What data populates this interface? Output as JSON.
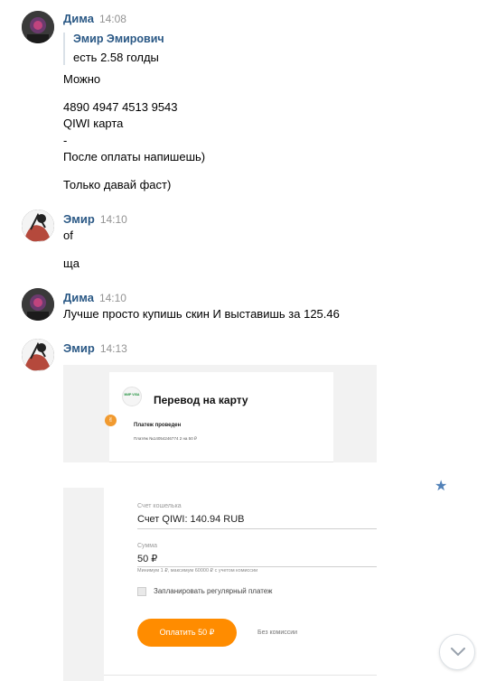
{
  "messages": [
    {
      "author": "Дима",
      "time": "14:08",
      "forward": {
        "name": "Эмир Эмирович",
        "text": "есть 2.58 голды"
      },
      "lines": [
        "Можно",
        "4890 4947 4513 9543",
        "QIWI карта",
        "-",
        "После оплаты напишешь)",
        "Только давай фаст)"
      ]
    },
    {
      "author": "Эмир",
      "time": "14:10",
      "lines": [
        "of",
        "ща"
      ]
    },
    {
      "author": "Дима",
      "time": "14:10",
      "lines": [
        "Лучше просто купишь скин И выставишь за 125.46"
      ]
    },
    {
      "author": "Эмир",
      "time": "14:13",
      "lines": []
    }
  ],
  "screenshot1": {
    "badge": "МИР VISA",
    "title": "Перевод на карту",
    "status": "Платеж проведен",
    "detail": "Платёж №14054246774 2 на 50 ₽"
  },
  "screenshot2": {
    "wallet_label": "Счет кошелька",
    "wallet_value": "Счет QIWI: 140.94 RUB",
    "amount_label": "Сумма",
    "amount_value": "50 ₽",
    "amount_hint": "Минимум 1 ₽, максимум 60000 ₽ с учетом комиссии",
    "schedule_label": "Запланировать регулярный платеж",
    "pay_button": "Оплатить 50 ₽",
    "no_fee": "Без комиссии"
  },
  "icons": {
    "star": "star-icon",
    "scroll": "chevron-down-icon",
    "hand": "thumb-icon"
  },
  "colors": {
    "author": "#2a5885",
    "time": "#939393",
    "accent": "#ff8c00",
    "star": "#5181b8"
  }
}
